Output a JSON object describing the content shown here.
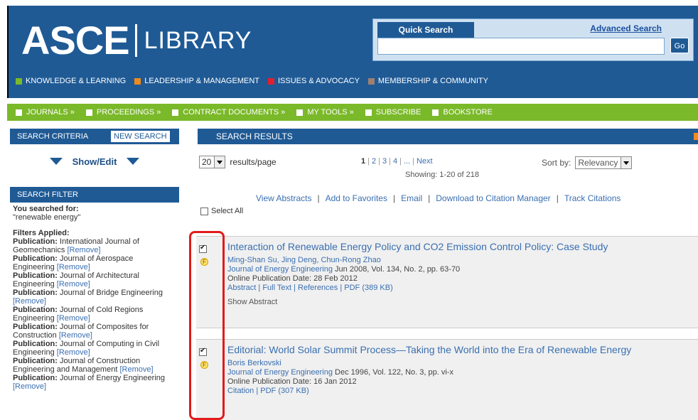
{
  "header": {
    "logo_text": "ASCE",
    "logo_sub": "LIBRARY",
    "quick_search_label": "Quick Search",
    "advanced_search_label": "Advanced Search",
    "search_value": "",
    "go_label": "Go",
    "nav": [
      {
        "label": "KNOWLEDGE & LEARNING",
        "color": "#7ab929"
      },
      {
        "label": "LEADERSHIP & MANAGEMENT",
        "color": "#f08a1c"
      },
      {
        "label": "ISSUES & ADVOCACY",
        "color": "#e0202e"
      },
      {
        "label": "MEMBERSHIP & COMMUNITY",
        "color": "#a08070"
      }
    ]
  },
  "green_nav": [
    {
      "label": "JOURNALS »"
    },
    {
      "label": "PROCEEDINGS »"
    },
    {
      "label": "CONTRACT DOCUMENTS »"
    },
    {
      "label": "MY TOOLS »"
    },
    {
      "label": "SUBSCRIBE"
    },
    {
      "label": "BOOKSTORE"
    }
  ],
  "sidebar": {
    "criteria_label": "SEARCH CRITERIA",
    "new_search_label": "NEW SEARCH",
    "show_edit_label": "Show/Edit",
    "filter_label": "SEARCH FILTER",
    "searched_for_label": "You searched for:",
    "searched_for_value": "\"renewable energy\"",
    "filters_applied_label": "Filters Applied:",
    "publication_label": "Publication:",
    "remove_label": "[Remove]",
    "filters": [
      "International Journal of Geomechanics",
      "Journal of Aerospace Engineering",
      "Journal of Architectural Engineering",
      "Journal of Bridge Engineering",
      "Journal of Cold Regions Engineering",
      "Journal of Composites for Construction",
      "Journal of Computing in Civil Engineering",
      "Journal of Construction Engineering and Management",
      "Journal of Energy Engineering"
    ]
  },
  "results": {
    "header_label": "SEARCH RESULTS",
    "per_page_value": "20",
    "per_page_label": "results/page",
    "pages": [
      "1",
      "2",
      "3",
      "4",
      "...",
      "Next"
    ],
    "showing": "Showing: 1-20 of 218",
    "sort_label": "Sort by:",
    "sort_value": "Relevancy",
    "actions": [
      "View Abstracts",
      "Add to Favorites",
      "Email",
      "Download to Citation Manager",
      "Track Citations"
    ],
    "select_all_label": "Select All",
    "items": [
      {
        "title": "Interaction of Renewable Energy Policy and CO2 Emission Control Policy: Case Study",
        "authors": "Ming-Shan Su, Jing Deng, Chun-Rong Zhao",
        "journal": "Journal of Energy Engineering",
        "citation": "Jun 2008, Vol. 134, No. 2, pp. 63-70",
        "online_date": "Online Publication Date: 28 Feb 2012",
        "links": "Abstract | Full Text | References | PDF (389 KB)",
        "show_abstract": "Show Abstract",
        "checked": true
      },
      {
        "title": "Editorial: World Solar Summit Process—Taking the World into the Era of Renewable Energy",
        "authors": "Boris Berkovski",
        "journal": "Journal of Energy Engineering",
        "citation": "Dec 1996, Vol. 122, No. 3, pp. vi-x",
        "online_date": "Online Publication Date: 16 Jan 2012",
        "links": "Citation | PDF (307 KB)",
        "show_abstract": "",
        "checked": true
      }
    ]
  }
}
